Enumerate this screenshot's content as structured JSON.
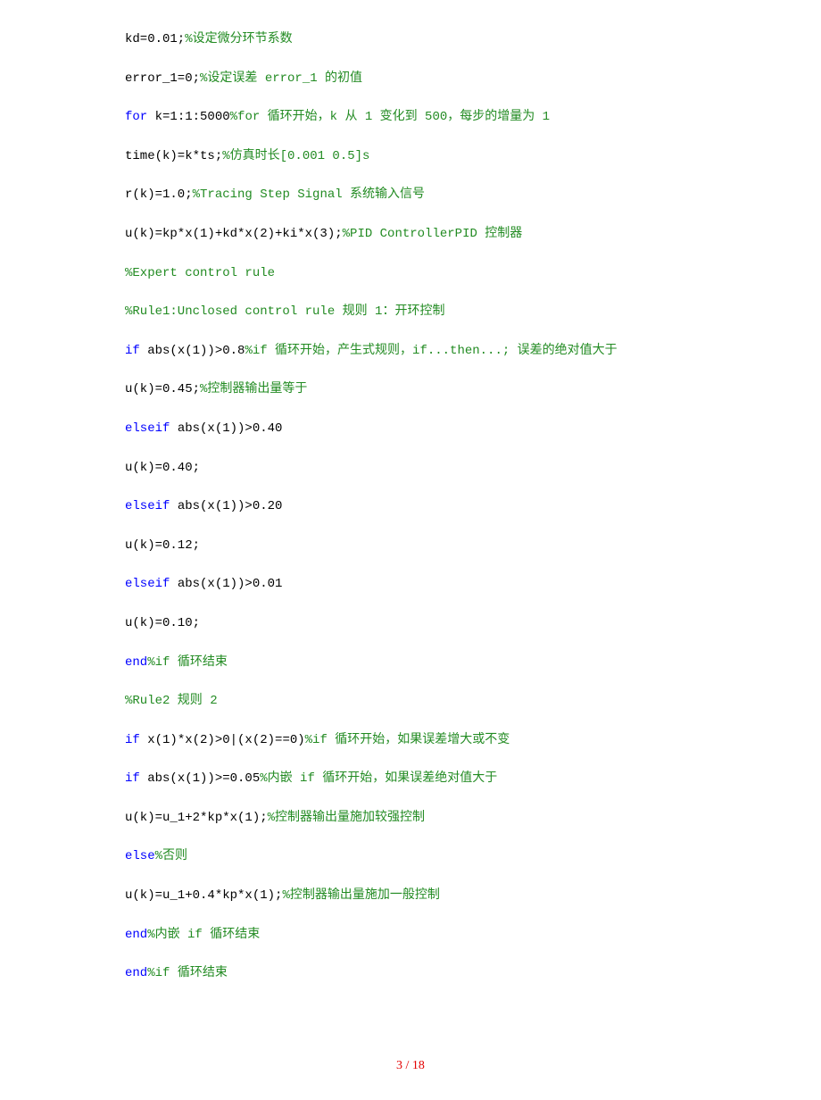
{
  "lines": [
    {
      "segments": [
        {
          "text": "kd=0.01;",
          "cls": "plain"
        },
        {
          "text": "%设定微分环节系数",
          "cls": "comment"
        }
      ]
    },
    {
      "segments": [
        {
          "text": "error_1=0;",
          "cls": "plain"
        },
        {
          "text": "%设定误差 error_1 的初值",
          "cls": "comment"
        }
      ]
    },
    {
      "segments": [
        {
          "text": "for",
          "cls": "keyword"
        },
        {
          "text": " k=1:1:5000",
          "cls": "plain"
        },
        {
          "text": "%for 循环开始，k 从 1 变化到 500，每步的增量为 1",
          "cls": "comment"
        }
      ]
    },
    {
      "segments": [
        {
          "text": "time(k)=k*ts;",
          "cls": "plain"
        },
        {
          "text": "%仿真时长[0.001 0.5]s",
          "cls": "comment"
        }
      ]
    },
    {
      "segments": [
        {
          "text": "r(k)=1.0;",
          "cls": "plain"
        },
        {
          "text": "%Tracing Step Signal 系统输入信号",
          "cls": "comment"
        }
      ]
    },
    {
      "segments": [
        {
          "text": "u(k)=kp*x(1)+kd*x(2)+ki*x(3);",
          "cls": "plain"
        },
        {
          "text": "%PID ControllerPID 控制器",
          "cls": "comment"
        }
      ]
    },
    {
      "segments": [
        {
          "text": "%Expert control rule",
          "cls": "comment"
        }
      ]
    },
    {
      "segments": [
        {
          "text": "%Rule1:Unclosed control rule 规则 1：开环控制",
          "cls": "comment"
        }
      ]
    },
    {
      "segments": [
        {
          "text": "if",
          "cls": "keyword"
        },
        {
          "text": " abs(x(1))>0.8",
          "cls": "plain"
        },
        {
          "text": "%if 循环开始，产生式规则，if...then...; 误差的绝对值大于",
          "cls": "comment"
        }
      ]
    },
    {
      "segments": [
        {
          "text": "u(k)=0.45;",
          "cls": "plain"
        },
        {
          "text": "%控制器输出量等于",
          "cls": "comment"
        }
      ]
    },
    {
      "segments": [
        {
          "text": "elseif",
          "cls": "keyword"
        },
        {
          "text": " abs(x(1))>0.40",
          "cls": "plain"
        }
      ]
    },
    {
      "segments": [
        {
          "text": "u(k)=0.40;",
          "cls": "plain"
        }
      ]
    },
    {
      "segments": [
        {
          "text": "elseif",
          "cls": "keyword"
        },
        {
          "text": " abs(x(1))>0.20",
          "cls": "plain"
        }
      ]
    },
    {
      "segments": [
        {
          "text": "u(k)=0.12;",
          "cls": "plain"
        }
      ]
    },
    {
      "segments": [
        {
          "text": "elseif",
          "cls": "keyword"
        },
        {
          "text": " abs(x(1))>0.01",
          "cls": "plain"
        }
      ]
    },
    {
      "segments": [
        {
          "text": "u(k)=0.10;",
          "cls": "plain"
        }
      ]
    },
    {
      "segments": [
        {
          "text": "end",
          "cls": "keyword"
        },
        {
          "text": "%if 循环结束",
          "cls": "comment"
        }
      ]
    },
    {
      "segments": [
        {
          "text": "%Rule2 规则 2",
          "cls": "comment"
        }
      ]
    },
    {
      "segments": [
        {
          "text": "if",
          "cls": "keyword"
        },
        {
          "text": " x(1)*x(2)>0|(x(2)==0)",
          "cls": "plain"
        },
        {
          "text": "%if 循环开始，如果误差增大或不变",
          "cls": "comment"
        }
      ]
    },
    {
      "segments": [
        {
          "text": "if",
          "cls": "keyword"
        },
        {
          "text": " abs(x(1))>=0.05",
          "cls": "plain"
        },
        {
          "text": "%内嵌 if 循环开始，如果误差绝对值大于",
          "cls": "comment"
        }
      ]
    },
    {
      "segments": [
        {
          "text": "u(k)=u_1+2*kp*x(1);",
          "cls": "plain"
        },
        {
          "text": "%控制器输出量施加较强控制",
          "cls": "comment"
        }
      ]
    },
    {
      "segments": [
        {
          "text": "else",
          "cls": "keyword"
        },
        {
          "text": "%否则",
          "cls": "comment"
        }
      ]
    },
    {
      "segments": [
        {
          "text": "u(k)=u_1+0.4*kp*x(1);",
          "cls": "plain"
        },
        {
          "text": "%控制器输出量施加一般控制",
          "cls": "comment"
        }
      ]
    },
    {
      "segments": [
        {
          "text": "end",
          "cls": "keyword"
        },
        {
          "text": "%内嵌 if 循环结束",
          "cls": "comment"
        }
      ]
    },
    {
      "segments": [
        {
          "text": "end",
          "cls": "keyword"
        },
        {
          "text": "%if 循环结束",
          "cls": "comment"
        }
      ]
    }
  ],
  "footer": "3 / 18"
}
